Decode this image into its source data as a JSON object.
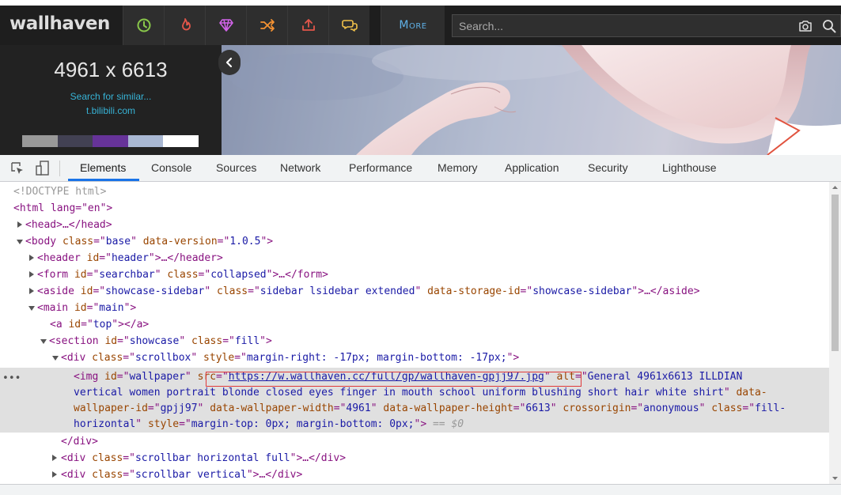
{
  "site": {
    "logo": "wallhaven",
    "nav": [
      {
        "name": "latest",
        "color": "#89c74a"
      },
      {
        "name": "hot",
        "color": "#e2564a"
      },
      {
        "name": "toplist",
        "color": "#d163e8"
      },
      {
        "name": "random",
        "color": "#f59232"
      },
      {
        "name": "upload",
        "color": "#e2564a"
      },
      {
        "name": "forums",
        "color": "#f2c24a"
      }
    ],
    "more_label": "More",
    "search_placeholder": "Search...",
    "colors": {
      "link": "#37b3d6",
      "more": "#5fb0e6"
    }
  },
  "sidebar": {
    "resolution": "4961 x 6613",
    "search_similar": "Search for similar...",
    "source": "t.bilibili.com",
    "palette": [
      "#999999",
      "#424153",
      "#663399",
      "#a9b8d3",
      "#ffffff"
    ]
  },
  "devtools": {
    "tabs": [
      "Elements",
      "Console",
      "Sources",
      "Network",
      "Performance",
      "Memory",
      "Application",
      "Security",
      "Lighthouse"
    ],
    "active_tab": "Elements",
    "dom": {
      "doctype": "<!DOCTYPE html>",
      "html_open": "<html lang=\"en\">",
      "head": "<head>…</head>",
      "body": {
        "tag": "body",
        "attrs": [
          [
            "class",
            "base"
          ],
          [
            "data-version",
            "1.0.5"
          ]
        ]
      },
      "header": {
        "tag": "header",
        "attrs": [
          [
            "id",
            "header"
          ]
        ],
        "collapsed": "…</header>"
      },
      "form": {
        "tag": "form",
        "attrs": [
          [
            "id",
            "searchbar"
          ],
          [
            "class",
            "collapsed"
          ]
        ],
        "collapsed": "…</form>"
      },
      "aside": {
        "tag": "aside",
        "attrs": [
          [
            "id",
            "showcase-sidebar"
          ],
          [
            "class",
            "sidebar lsidebar extended"
          ],
          [
            "data-storage-id",
            "showcase-sidebar"
          ]
        ],
        "collapsed": "…</aside>"
      },
      "main": {
        "tag": "main",
        "attrs": [
          [
            "id",
            "main"
          ]
        ]
      },
      "a": {
        "tag": "a",
        "attrs": [
          [
            "id",
            "top"
          ]
        ],
        "close": "</a>"
      },
      "section": {
        "tag": "section",
        "attrs": [
          [
            "id",
            "showcase"
          ],
          [
            "class",
            "fill"
          ]
        ]
      },
      "div_scrollbox": {
        "tag": "div",
        "attrs": [
          [
            "class",
            "scrollbox"
          ],
          [
            "style",
            "margin-right: -17px; margin-bottom: -17px;"
          ]
        ]
      },
      "img": {
        "id": "wallpaper",
        "src": "https://w.wallhaven.cc/full/gp/wallhaven-gpjj97.jpg",
        "alt": "General 4961x6613 ILLDIAN vertical women portrait blonde closed eyes finger in mouth school uniform blushing short hair white shirt",
        "wallpaper_id": "gpjj97",
        "width": "4961",
        "height": "6613",
        "crossorigin": "anonymous",
        "class": "fill-horizontal",
        "style": "margin-top: 0px; margin-bottom: 0px;",
        "eq": " == $0"
      },
      "div_close": "</div>",
      "scrollbar_h": {
        "tag": "div",
        "attrs": [
          [
            "class",
            "scrollbar horizontal full"
          ]
        ],
        "collapsed": "…</div>"
      },
      "scrollbar_v": {
        "tag": "div",
        "attrs": [
          [
            "class",
            "scrollbar vertical"
          ]
        ],
        "collapsed": "…</div>"
      }
    }
  }
}
